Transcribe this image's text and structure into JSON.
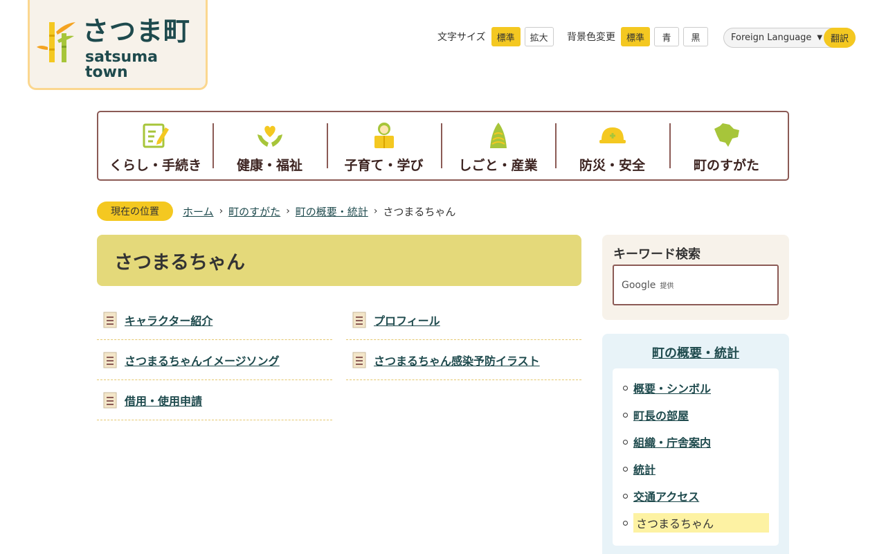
{
  "logo": {
    "name_ja": "さつま町",
    "name_en": "satsuma town"
  },
  "utility": {
    "font_size_label": "文字サイズ",
    "font_size_options": [
      "標準",
      "拡大"
    ],
    "bg_color_label": "背景色変更",
    "bg_color_options": [
      "標準",
      "青",
      "黒"
    ],
    "language_select": "Foreign Language",
    "translate_button": "翻訳"
  },
  "nav": [
    {
      "label": "くらし・手続き",
      "icon": "notepad-pencil-icon"
    },
    {
      "label": "健康・福祉",
      "icon": "heart-hands-icon"
    },
    {
      "label": "子育て・学び",
      "icon": "child-reading-icon"
    },
    {
      "label": "しごと・産業",
      "icon": "bamboo-shoot-icon"
    },
    {
      "label": "防災・安全",
      "icon": "helmet-icon"
    },
    {
      "label": "町のすがた",
      "icon": "town-map-icon"
    }
  ],
  "breadcrumb": {
    "label": "現在の位置",
    "items": [
      "ホーム",
      "町のすがた",
      "町の概要・統計"
    ],
    "current": "さつまるちゃん"
  },
  "page_title": "さつまるちゃん",
  "links": [
    "キャラクター紹介",
    "プロフィール",
    "さつまるちゃんイメージソング",
    "さつまるちゃん感染予防イラスト",
    "借用・使用申請"
  ],
  "search": {
    "title": "キーワード検索",
    "provider": "Google",
    "provided": "提供"
  },
  "side_nav": {
    "title": "町の概要・統計",
    "items": [
      "概要・シンボル",
      "町長の部屋",
      "組織・庁舎案内",
      "統計",
      "交通アクセス"
    ],
    "current": "さつまるちゃん"
  },
  "colors": {
    "accent_yellow": "#f4c821",
    "title_bg": "#e4d97a",
    "nav_border": "#8b5a55",
    "link_text": "#1e4a4d",
    "side_bg": "#e8f3f8",
    "logo_bg": "#f7f2ea"
  }
}
